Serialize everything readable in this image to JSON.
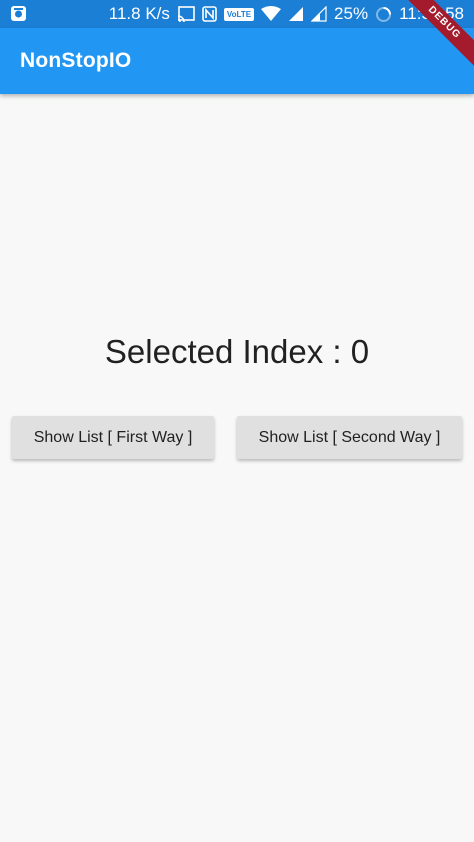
{
  "status_bar": {
    "speed": "11.8 K/s",
    "battery": "25%",
    "time": "11:58:58",
    "volte": "VoLTE",
    "icons": [
      "app-notification-icon",
      "cast-icon",
      "nfc-icon",
      "volte-icon",
      "wifi-icon",
      "signal-icon",
      "signal-icon-2",
      "loading-spinner-icon"
    ]
  },
  "app_bar": {
    "title": "NonStopIO",
    "color": "#2196f3"
  },
  "debug_ribbon": {
    "label": "DEBUG"
  },
  "main": {
    "selected_label": "Selected Index : 0",
    "button_first": "Show List [ First Way ]",
    "button_second": "Show List [ Second Way ]"
  }
}
